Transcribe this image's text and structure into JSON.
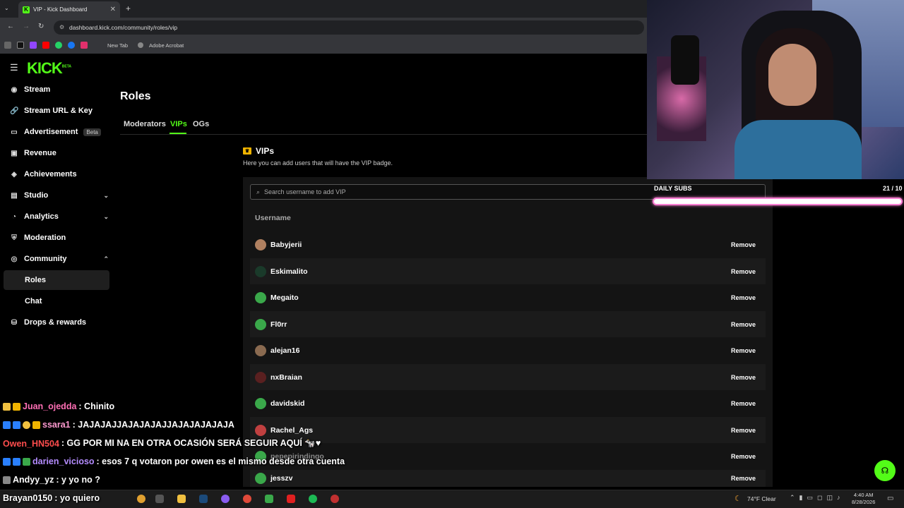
{
  "browser": {
    "tab_title": "VIP - Kick Dashboard",
    "url": "dashboard.kick.com/community/roles/vip",
    "bookmarks": [
      "New Tab",
      "Adobe Acrobat"
    ]
  },
  "brand": {
    "logo": "KICK",
    "logo_sup": "BETA",
    "accent": "#53fc18"
  },
  "sidebar": {
    "items": [
      {
        "label": "Stream",
        "icon": "radio-icon"
      },
      {
        "label": "Stream URL & Key",
        "icon": "link-icon"
      },
      {
        "label": "Advertisement",
        "icon": "ad-icon",
        "badge": "Beta"
      },
      {
        "label": "Revenue",
        "icon": "revenue-icon"
      },
      {
        "label": "Achievements",
        "icon": "achievements-icon"
      },
      {
        "label": "Studio",
        "icon": "studio-icon"
      },
      {
        "label": "Analytics",
        "icon": "analytics-icon"
      },
      {
        "label": "Moderation",
        "icon": "moderation-icon"
      },
      {
        "label": "Community",
        "icon": "community-icon"
      },
      {
        "label": "Roles"
      },
      {
        "label": "Chat"
      },
      {
        "label": "Drops & rewards",
        "icon": "drops-icon"
      }
    ]
  },
  "main": {
    "title": "Roles",
    "tabs": [
      "Moderators",
      "VIPs",
      "OGs"
    ],
    "active_tab": "VIPs",
    "section_title": "VIPs",
    "section_desc": "Here you can add users that will have the VIP badge.",
    "search_placeholder": "Search username to add VIP",
    "column_header": "Username",
    "remove_label": "Remove",
    "vips": [
      "Babyjerii",
      "Eskimalito",
      "Megaito",
      "Fl0rr",
      "alejan16",
      "nxBraian",
      "davidskid",
      "Rachel_Ags",
      "pepepirindingo",
      "jesszv"
    ]
  },
  "overlay": {
    "subs_label": "DAILY SUBS",
    "subs_count": "21 / 10",
    "subs_progress": 1.0,
    "chat": [
      {
        "user": "Juan_ojedda",
        "msg": ": Chinito",
        "color": "#ff6fb5"
      },
      {
        "user": "ssara1",
        "msg": ": JAJAJAJJAJAJAJAJJAJAJAJAJAJA",
        "color": "#ff9ad0"
      },
      {
        "user": "Owen_HN504",
        "msg": ": GG POR MI NA EN OTRA OCASIÓN SERÁ SEGUIR AQUÍ 🐄♥",
        "color": "#ff4d4d"
      },
      {
        "user": "darien_vicioso",
        "msg": ": esos 7 q votaron por owen es el mismo desde otra cuenta",
        "color": "#b48cff"
      },
      {
        "user": "Andyy_yz",
        "msg": ": y yo no ?",
        "color": "#ffffff"
      },
      {
        "user": "Brayan0150",
        "msg": ": yo quiero",
        "color": "#ffffff"
      }
    ]
  },
  "taskbar": {
    "weather": "74°F Clear",
    "time": "4:40 AM",
    "date": "8/28/2026"
  }
}
